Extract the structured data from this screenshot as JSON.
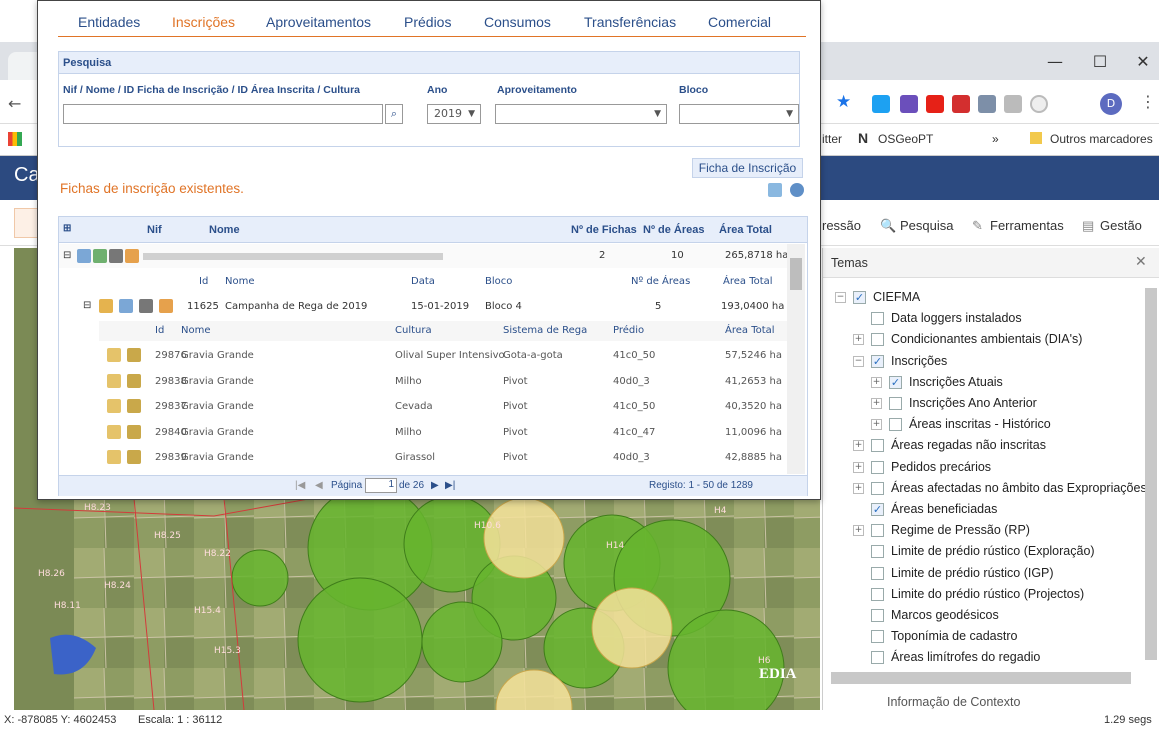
{
  "browser": {
    "bookmarks": {
      "twitter_partial": "itter",
      "osgeo": "OSGeoPT",
      "overflow": "»",
      "other": "Outros marcadores"
    },
    "window_controls": {
      "minimize": "—",
      "maximize": "☐",
      "close": "✕"
    },
    "profile_initial": "D"
  },
  "app": {
    "title_partial": "Ca",
    "toolbar": {
      "pressao_partial": "ressão",
      "pesquisa": "Pesquisa",
      "ferramentas": "Ferramentas",
      "gestao": "Gestão"
    }
  },
  "popup": {
    "nav_tabs": [
      "Entidades",
      "Inscrições",
      "Aproveitamentos",
      "Prédios",
      "Consumos",
      "Transferências",
      "Comercial"
    ],
    "active_tab": "Inscrições",
    "search": {
      "header": "Pesquisa",
      "field_label": "Nif / Nome / ID Ficha de Inscrição / ID Área Inscrita / Cultura",
      "field_value": "",
      "ano_label": "Ano",
      "ano_value": "2019",
      "aprov_label": "Aproveitamento",
      "aprov_value": "",
      "bloco_label": "Bloco",
      "bloco_value": ""
    },
    "ficha_button": "Ficha de Inscrição",
    "existing_title": "Fichas de inscrição existentes.",
    "grid": {
      "headers": {
        "nif": "Nif",
        "nome": "Nome",
        "fichas": "Nº de Fichas",
        "areas": "Nº de Áreas",
        "total": "Área Total"
      },
      "entity": {
        "fichas": "2",
        "areas": "10",
        "total": "265,8718 ha"
      },
      "sub_headers": {
        "id": "Id",
        "nome": "Nome",
        "data": "Data",
        "bloco": "Bloco",
        "areas": "Nº de Áreas",
        "total": "Área Total"
      },
      "sub_row": {
        "id": "11625",
        "nome": "Campanha de Rega de 2019",
        "data": "15-01-2019",
        "bloco": "Bloco 4",
        "areas": "5",
        "total": "193,0400 ha"
      },
      "area_headers": {
        "id": "Id",
        "nome": "Nome",
        "cultura": "Cultura",
        "sistema": "Sistema de Rega",
        "predio": "Prédio",
        "total": "Área Total"
      },
      "area_rows": [
        {
          "id": "29876",
          "nome": "Gravia Grande",
          "cultura": "Olival Super Intensivo",
          "sistema": "Gota-a-gota",
          "predio": "41c0_50",
          "total": "57,5246 ha"
        },
        {
          "id": "29838",
          "nome": "Gravia Grande",
          "cultura": "Milho",
          "sistema": "Pivot",
          "predio": "40d0_3",
          "total": "41,2653 ha"
        },
        {
          "id": "29837",
          "nome": "Gravia Grande",
          "cultura": "Cevada",
          "sistema": "Pivot",
          "predio": "41c0_50",
          "total": "40,3520 ha"
        },
        {
          "id": "29840",
          "nome": "Gravia Grande",
          "cultura": "Milho",
          "sistema": "Pivot",
          "predio": "41c0_47",
          "total": "11,0096 ha"
        },
        {
          "id": "29839",
          "nome": "Gravia Grande",
          "cultura": "Girassol",
          "sistema": "Pivot",
          "predio": "40d0_3",
          "total": "42,8885 ha"
        }
      ],
      "pager": {
        "page_label": "Página",
        "page_value": "1",
        "of_label": "de 26",
        "registo": "Registo: 1 - 50 de 1289"
      }
    }
  },
  "temas": {
    "title": "Temas",
    "close": "✕",
    "items": [
      {
        "label": "CIEFMA",
        "level": 0,
        "expander": "−",
        "checked": true
      },
      {
        "label": "Data loggers instalados",
        "level": 1,
        "expander": "",
        "checked": false
      },
      {
        "label": "Condicionantes ambientais (DIA's)",
        "level": 1,
        "expander": "+",
        "checked": false
      },
      {
        "label": "Inscrições",
        "level": 1,
        "expander": "−",
        "checked": true
      },
      {
        "label": "Inscrições Atuais",
        "level": 2,
        "expander": "+",
        "checked": true
      },
      {
        "label": "Inscrições Ano Anterior",
        "level": 2,
        "expander": "+",
        "checked": false
      },
      {
        "label": "Áreas inscritas - Histórico",
        "level": 2,
        "expander": "+",
        "checked": false
      },
      {
        "label": "Áreas regadas não inscritas",
        "level": 1,
        "expander": "+",
        "checked": false
      },
      {
        "label": "Pedidos precários",
        "level": 1,
        "expander": "+",
        "checked": false
      },
      {
        "label": "Áreas afectadas no âmbito das Expropriações",
        "level": 1,
        "expander": "+",
        "checked": false
      },
      {
        "label": "Áreas beneficiadas",
        "level": 1,
        "expander": "",
        "checked": true
      },
      {
        "label": "Regime de Pressão (RP)",
        "level": 1,
        "expander": "+",
        "checked": false
      },
      {
        "label": "Limite de prédio rústico (Exploração)",
        "level": 1,
        "expander": "",
        "checked": false
      },
      {
        "label": "Limite de prédio rústico (IGP)",
        "level": 1,
        "expander": "",
        "checked": false
      },
      {
        "label": "Limite do prédio rústico (Projectos)",
        "level": 1,
        "expander": "",
        "checked": false
      },
      {
        "label": "Marcos geodésicos",
        "level": 1,
        "expander": "",
        "checked": false
      },
      {
        "label": "Toponímia de cadastro",
        "level": 1,
        "expander": "",
        "checked": false
      },
      {
        "label": "Áreas limítrofes do regadio",
        "level": 1,
        "expander": "",
        "checked": false
      }
    ],
    "partial_item": "Informação de Contexto"
  },
  "status": {
    "coords": "X: -878085 Y: 4602453",
    "scale": "Escala: 1 : 36112",
    "timing": "1.29 segs"
  },
  "map": {
    "logo": "EDIA"
  }
}
